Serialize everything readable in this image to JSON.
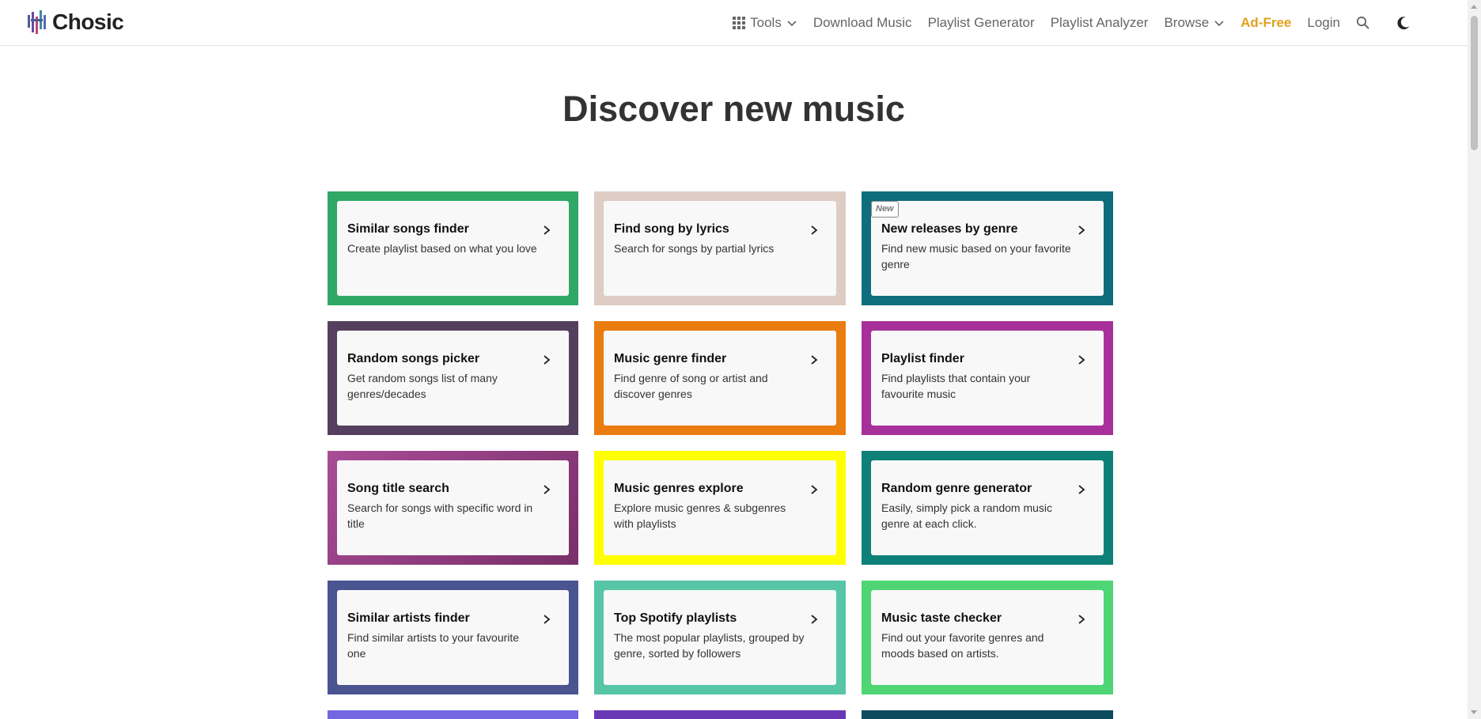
{
  "header": {
    "logo_text": "Chosic",
    "nav": [
      {
        "label": "Tools",
        "icon": "grid-icon",
        "dropdown": true
      },
      {
        "label": "Download Music"
      },
      {
        "label": "Playlist Generator"
      },
      {
        "label": "Playlist Analyzer"
      },
      {
        "label": "Browse",
        "dropdown": true
      },
      {
        "label": "Ad-Free",
        "color": "#e0a21c"
      },
      {
        "label": "Login"
      }
    ],
    "search_icon": "search-icon",
    "theme_icon": "moon-icon"
  },
  "main": {
    "title": "Discover new music",
    "cards": [
      {
        "title": "Similar songs finder",
        "desc": "Create playlist based on what you love",
        "color": "#2fa866"
      },
      {
        "title": "Find song by lyrics",
        "desc": "Search for songs by partial lyrics",
        "color": "#ddcdc4"
      },
      {
        "title": "New releases by genre",
        "desc": "Find new music based on your favorite genre",
        "color": "#0e6e7b",
        "badge": "New"
      },
      {
        "title": "Random songs picker",
        "desc": "Get random songs list of many genres/decades",
        "color": "#54405e"
      },
      {
        "title": "Music genre finder",
        "desc": "Find genre of song or artist and discover genres",
        "color": "#ea7c10"
      },
      {
        "title": "Playlist finder",
        "desc": "Find playlists that contain your favourite music",
        "color": "#a8309a"
      },
      {
        "title": "Song title search",
        "desc": "Search for songs with specific word in title",
        "color": "#a0458a",
        "gradient": [
          "#a84c96",
          "#7a2f6a"
        ]
      },
      {
        "title": "Music genres explore",
        "desc": "Explore music genres & subgenres with playlists",
        "color": "#ffff00"
      },
      {
        "title": "Random genre generator",
        "desc": "Easily, simply pick a random music genre at each click.",
        "color": "#0f8078"
      },
      {
        "title": "Similar artists finder",
        "desc": "Find similar artists to your favourite one",
        "color": "#4a5490"
      },
      {
        "title": "Top Spotify playlists",
        "desc": "The most popular playlists, grouped by genre, sorted by followers",
        "color": "#56c6a7"
      },
      {
        "title": "Music taste checker",
        "desc": "Find out your favorite genres and moods based on artists.",
        "color": "#4fd574"
      }
    ],
    "partial_row_colors": [
      "#7367e0",
      "#6a37b5",
      "#0d4b5e"
    ]
  }
}
